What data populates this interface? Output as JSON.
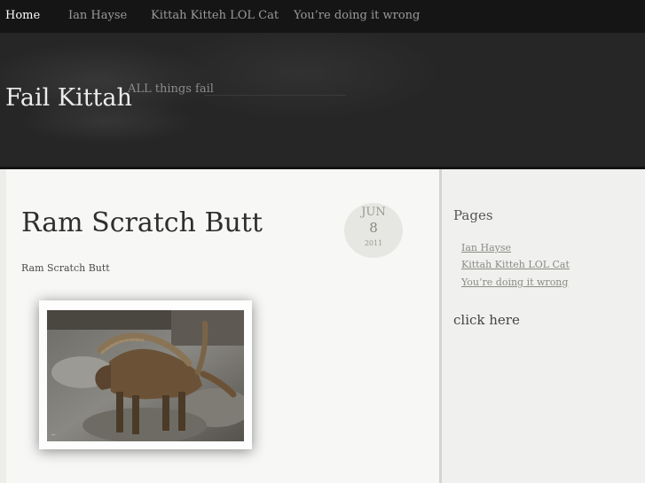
{
  "nav": {
    "items": [
      {
        "label": "Home",
        "active": true
      },
      {
        "label": "Ian Hayse",
        "active": false
      },
      {
        "label": "Kittah Kitteh LOL Cat",
        "active": false
      },
      {
        "label": "You’re doing it wrong",
        "active": false
      }
    ]
  },
  "header": {
    "site_title": "Fail Kittah",
    "tagline": "ALL things fail"
  },
  "post": {
    "title": "Ram Scratch Butt",
    "date": {
      "month": "JUN",
      "day": "8",
      "year": "2011"
    },
    "text": "Ram Scratch Butt",
    "image": {
      "description_icon": "ibex-photo"
    }
  },
  "sidebar": {
    "pages_title": "Pages",
    "pages": [
      {
        "label": "Ian Hayse"
      },
      {
        "label": "Kittah Kitteh LOL Cat"
      },
      {
        "label": "You’re doing it wrong"
      }
    ],
    "click_here": "click here"
  },
  "colors": {
    "nav_bg": "#151515",
    "header_bg": "#262626",
    "content_bg": "#f7f7f5",
    "sidebar_bg": "#f0f0ee"
  }
}
